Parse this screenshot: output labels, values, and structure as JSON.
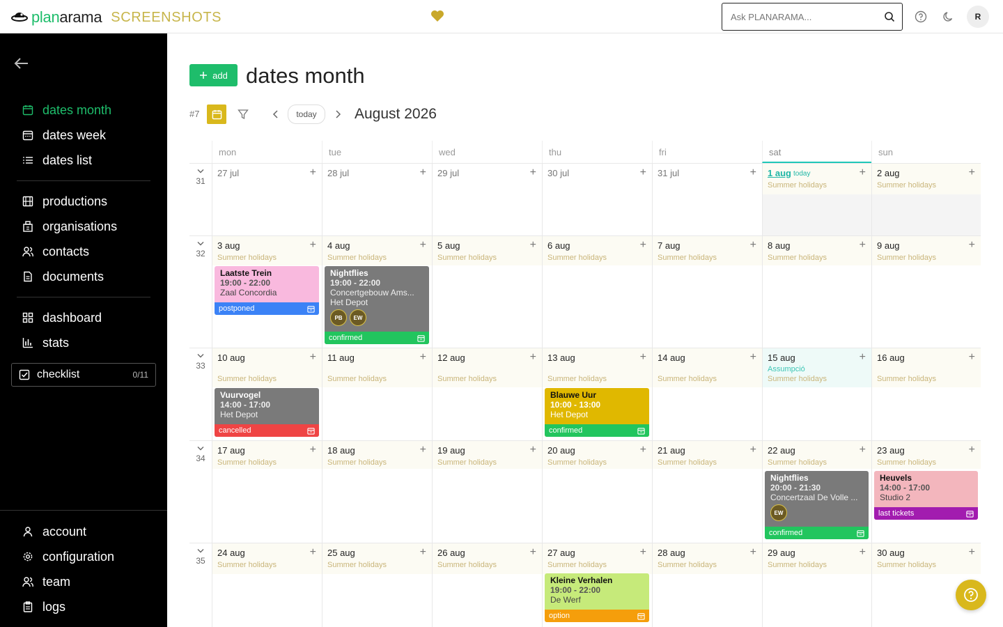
{
  "topbar": {
    "logo_plan": "plan",
    "logo_arama": "arama",
    "logo_tag": "SCREENSHOTS",
    "search_placeholder": "Ask PLANARAMA...",
    "avatar": "R"
  },
  "sidebar": {
    "primary": [
      {
        "label": "dates month"
      },
      {
        "label": "dates week"
      },
      {
        "label": "dates list"
      }
    ],
    "secondary": [
      {
        "label": "productions"
      },
      {
        "label": "organisations"
      },
      {
        "label": "contacts"
      },
      {
        "label": "documents"
      }
    ],
    "tertiary": [
      {
        "label": "dashboard"
      },
      {
        "label": "stats"
      }
    ],
    "checklist": {
      "label": "checklist",
      "count": "0/11"
    },
    "bottom": [
      {
        "label": "account"
      },
      {
        "label": "configuration"
      },
      {
        "label": "team"
      },
      {
        "label": "logs"
      }
    ]
  },
  "main": {
    "add_label": "add",
    "title": "dates month",
    "view_number": "#7",
    "today_label": "today",
    "month": "August 2026"
  },
  "calendar": {
    "days": [
      "mon",
      "tue",
      "wed",
      "thu",
      "fri",
      "sat",
      "sun"
    ],
    "weeks": [
      {
        "num": "31",
        "dates": [
          "27 jul",
          "28 jul",
          "29 jul",
          "30 jul",
          "31 jul",
          "1 aug",
          "2 aug"
        ]
      },
      {
        "num": "32",
        "dates": [
          "3 aug",
          "4 aug",
          "5 aug",
          "6 aug",
          "7 aug",
          "8 aug",
          "9 aug"
        ]
      },
      {
        "num": "33",
        "dates": [
          "10 aug",
          "11 aug",
          "12 aug",
          "13 aug",
          "14 aug",
          "15 aug",
          "16 aug"
        ]
      },
      {
        "num": "34",
        "dates": [
          "17 aug",
          "18 aug",
          "19 aug",
          "20 aug",
          "21 aug",
          "22 aug",
          "23 aug"
        ]
      },
      {
        "num": "35",
        "dates": [
          "24 aug",
          "25 aug",
          "26 aug",
          "27 aug",
          "28 aug",
          "29 aug",
          "30 aug"
        ]
      }
    ],
    "today_tag": "today",
    "holiday": "Summer holidays",
    "extra_holiday": "Assumpció"
  },
  "events": [
    {
      "title": "Laatste Trein",
      "time": "19:00 - 22:00",
      "venue": "Zaal Concordia",
      "status": "postponed",
      "bg": "#f9b9de",
      "sc": "#3b82f6"
    },
    {
      "title": "Nightflies",
      "time": "19:00 - 22:00",
      "venue": "Concertgebouw Ams...",
      "venue2": "Het Depot",
      "status": "confirmed",
      "bg": "#7a7a7a",
      "sc": "#22c55e",
      "avatars": [
        "PB",
        "EW"
      ]
    },
    {
      "title": "Vuurvogel",
      "time": "14:00 - 17:00",
      "venue": "Het Depot",
      "status": "cancelled",
      "bg": "#7a7a7a",
      "sc": "#ef4444"
    },
    {
      "title": "Blauwe Uur",
      "time": "10:00 - 13:00",
      "venue": "Het Depot",
      "status": "confirmed",
      "bg": "#e0b800",
      "sc": "#22c55e"
    },
    {
      "title": "Nightflies",
      "time": "20:00 - 21:30",
      "venue": "Concertzaal De Volle ...",
      "status": "confirmed",
      "bg": "#7a7a7a",
      "sc": "#22c55e",
      "avatars": [
        "EW"
      ]
    },
    {
      "title": "Heuvels",
      "time": "14:00 - 17:00",
      "venue": "Studio 2",
      "status": "last tickets",
      "bg": "#f3b6bd",
      "sc": "#a21caf"
    },
    {
      "title": "Kleine Verhalen",
      "time": "19:00 - 22:00",
      "venue": "De Werf",
      "status": "option",
      "bg": "#c6ea7a",
      "sc": "#f59e0b"
    }
  ]
}
